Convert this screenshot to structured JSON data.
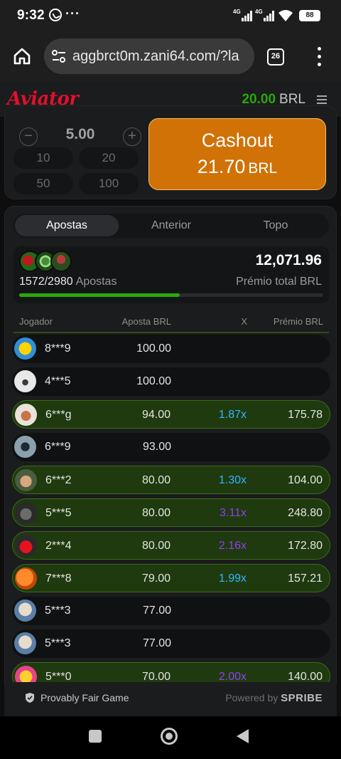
{
  "status_bar": {
    "time": "9:32",
    "overflow": "···",
    "signal_label_1": "4G",
    "signal_label_2": "4G",
    "battery": "88"
  },
  "browser": {
    "url": "aggbrct0m.zani64.com/?la",
    "tab_count": "26"
  },
  "game_header": {
    "logo": "Aviator",
    "balance": "20.00",
    "currency": "BRL"
  },
  "bet_panel": {
    "minus": "−",
    "amount": "5.00",
    "plus": "+",
    "quick_amounts": [
      "10",
      "20",
      "50",
      "100"
    ],
    "cashout_label": "Cashout",
    "cashout_amount": "21.70",
    "cashout_currency": "BRL",
    "accent_color": "#d07206"
  },
  "bets": {
    "tabs": [
      "Apostas",
      "Anterior",
      "Topo"
    ],
    "active_tab": "Apostas",
    "count": "1572/2980",
    "count_label": "Apostas",
    "total": "12,071.96",
    "total_label": "Prémio total BRL",
    "progress": 0.527,
    "columns": {
      "player": "Jogador",
      "bet": "Aposta BRL",
      "mult": "X",
      "win": "Prémio BRL"
    },
    "rows": [
      {
        "player": "8***9",
        "bet": "100.00",
        "mult": "",
        "win": "",
        "won": false,
        "mult_color": "",
        "avatar": "yellow-a"
      },
      {
        "player": "4***5",
        "bet": "100.00",
        "mult": "",
        "win": "",
        "won": false,
        "mult_color": "",
        "avatar": "white-plane"
      },
      {
        "player": "6***g",
        "bet": "94.00",
        "mult": "1.87x",
        "win": "175.78",
        "won": true,
        "mult_color": "#34b4ff",
        "avatar": "cat"
      },
      {
        "player": "6***9",
        "bet": "93.00",
        "mult": "",
        "win": "",
        "won": false,
        "mult_color": "",
        "avatar": "wolf"
      },
      {
        "player": "6***2",
        "bet": "80.00",
        "mult": "1.30x",
        "win": "104.00",
        "won": true,
        "mult_color": "#34b4ff",
        "avatar": "thumbs"
      },
      {
        "player": "5***5",
        "bet": "80.00",
        "mult": "3.11x",
        "win": "248.80",
        "won": true,
        "mult_color": "#913ef8",
        "avatar": "gorilla"
      },
      {
        "player": "2***4",
        "bet": "80.00",
        "mult": "2.16x",
        "win": "172.80",
        "won": true,
        "mult_color": "#913ef8",
        "avatar": "red-car"
      },
      {
        "player": "7***8",
        "bet": "79.00",
        "mult": "1.99x",
        "win": "157.21",
        "won": true,
        "mult_color": "#34b4ff",
        "avatar": "ball"
      },
      {
        "player": "5***3",
        "bet": "77.00",
        "mult": "",
        "win": "",
        "won": false,
        "mult_color": "",
        "avatar": "goat"
      },
      {
        "player": "5***3",
        "bet": "77.00",
        "mult": "",
        "win": "",
        "won": false,
        "mult_color": "",
        "avatar": "goat"
      },
      {
        "player": "5***0",
        "bet": "70.00",
        "mult": "2.00x",
        "win": "140.00",
        "won": true,
        "mult_color": "#913ef8",
        "avatar": "emoji"
      }
    ]
  },
  "footer": {
    "provably_fair": "Provably Fair Game",
    "powered_by": "Powered by",
    "brand": "SPRIBE"
  }
}
